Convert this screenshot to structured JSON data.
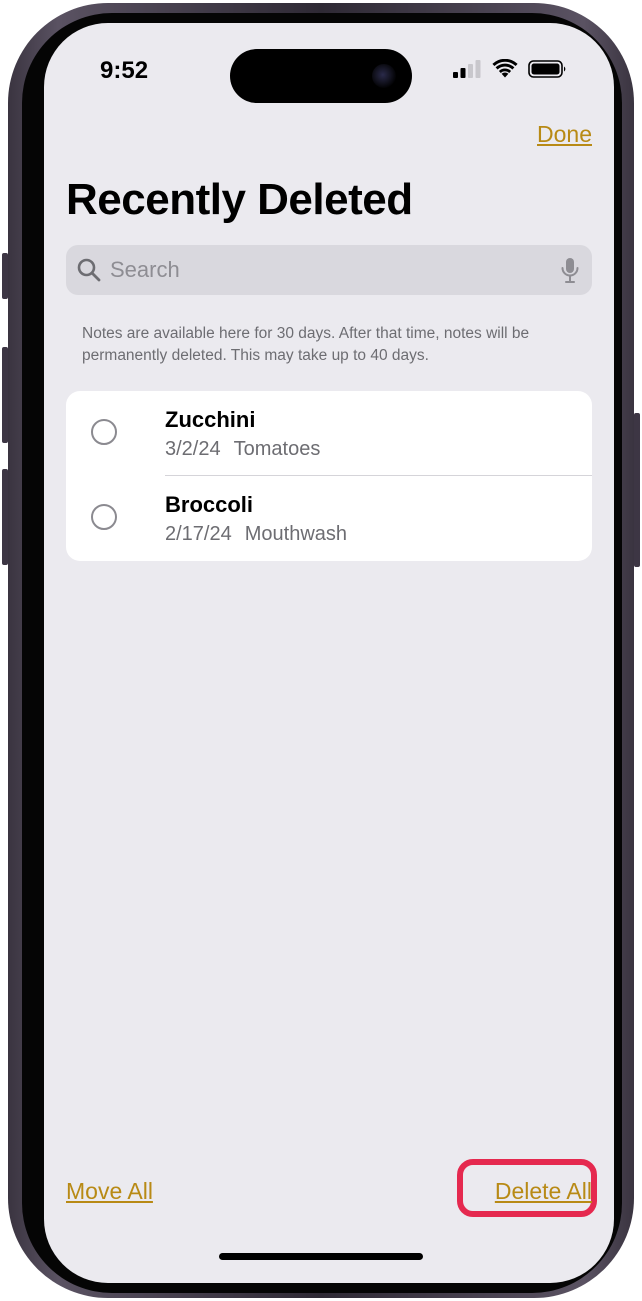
{
  "status_bar": {
    "time": "9:52"
  },
  "nav": {
    "done_label": "Done"
  },
  "page": {
    "title": "Recently Deleted"
  },
  "search": {
    "placeholder": "Search",
    "value": ""
  },
  "info_text": "Notes are available here for 30 days. After that time, notes will be permanently deleted. This may take up to 40 days.",
  "notes": [
    {
      "title": "Zucchini",
      "date": "3/2/24",
      "preview": "Tomatoes"
    },
    {
      "title": "Broccoli",
      "date": "2/17/24",
      "preview": "Mouthwash"
    }
  ],
  "toolbar": {
    "move_all_label": "Move All",
    "delete_all_label": "Delete All"
  },
  "icons": {
    "search": "magnifying-glass",
    "mic": "microphone",
    "signal": "cellular-signal",
    "wifi": "wifi",
    "battery": "battery"
  },
  "colors": {
    "accent": "#b88a15",
    "highlight": "#e5294f",
    "background": "#ebeaef"
  }
}
